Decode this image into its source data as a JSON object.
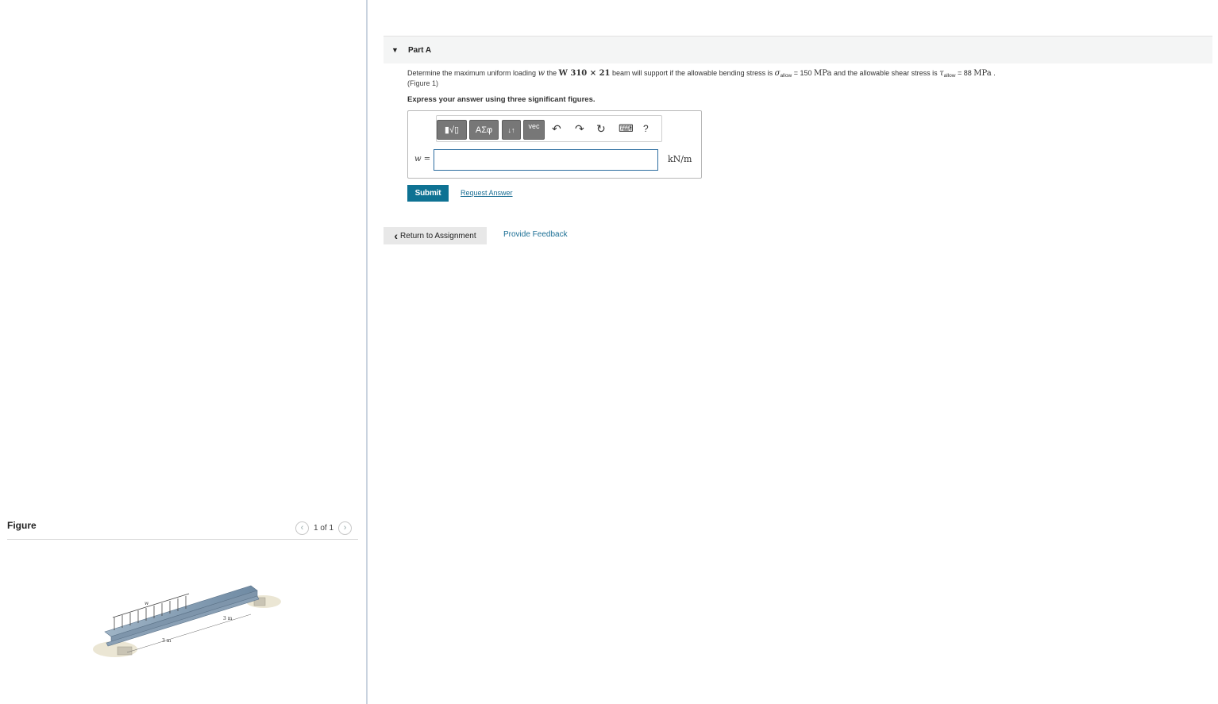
{
  "figure_pane": {
    "title": "Figure",
    "pager": "1 of 1",
    "prev_icon": "chevron-left-icon",
    "next_icon": "chevron-right-icon",
    "image_labels": {
      "load": "w",
      "span_left": "3 m",
      "span_right": "3 m"
    }
  },
  "part": {
    "toggle_icon": "▼",
    "title": "Part A"
  },
  "question": {
    "text_1": "Determine the maximum uniform loading ",
    "var_w": "w",
    "text_2": " the ",
    "beam": "W 310  ×  21",
    "text_3": " beam will support if the allowable bending stress is ",
    "sigma": "σ",
    "sigma_sub": "allow",
    "eq_1": " = 150 ",
    "unit_1": "MPa",
    "text_4": " and the allowable shear stress is ",
    "tau": "τ",
    "tau_sub": "allow",
    "eq_2": " = 88 ",
    "unit_2": "MPa",
    "end": " .",
    "figure_link": "(Figure 1)",
    "instruction": "Express your answer using three significant figures."
  },
  "toolbar": {
    "templates": "▮√▯",
    "greek": "ΑΣφ",
    "sort": "↓↑",
    "vec": "vec",
    "undo": "↶",
    "redo": "↷",
    "reset": "↻",
    "keyboard": "⌨",
    "help": "?"
  },
  "answer": {
    "label": "w =",
    "value": "",
    "unit": "kN/m"
  },
  "actions": {
    "submit": "Submit",
    "request_answer": "Request Answer",
    "return": "Return to Assignment",
    "return_icon": "‹",
    "feedback": "Provide Feedback"
  },
  "colors": {
    "submit_bg": "#0e7293",
    "link": "#1a6e94",
    "divider": "#c9d3df"
  }
}
